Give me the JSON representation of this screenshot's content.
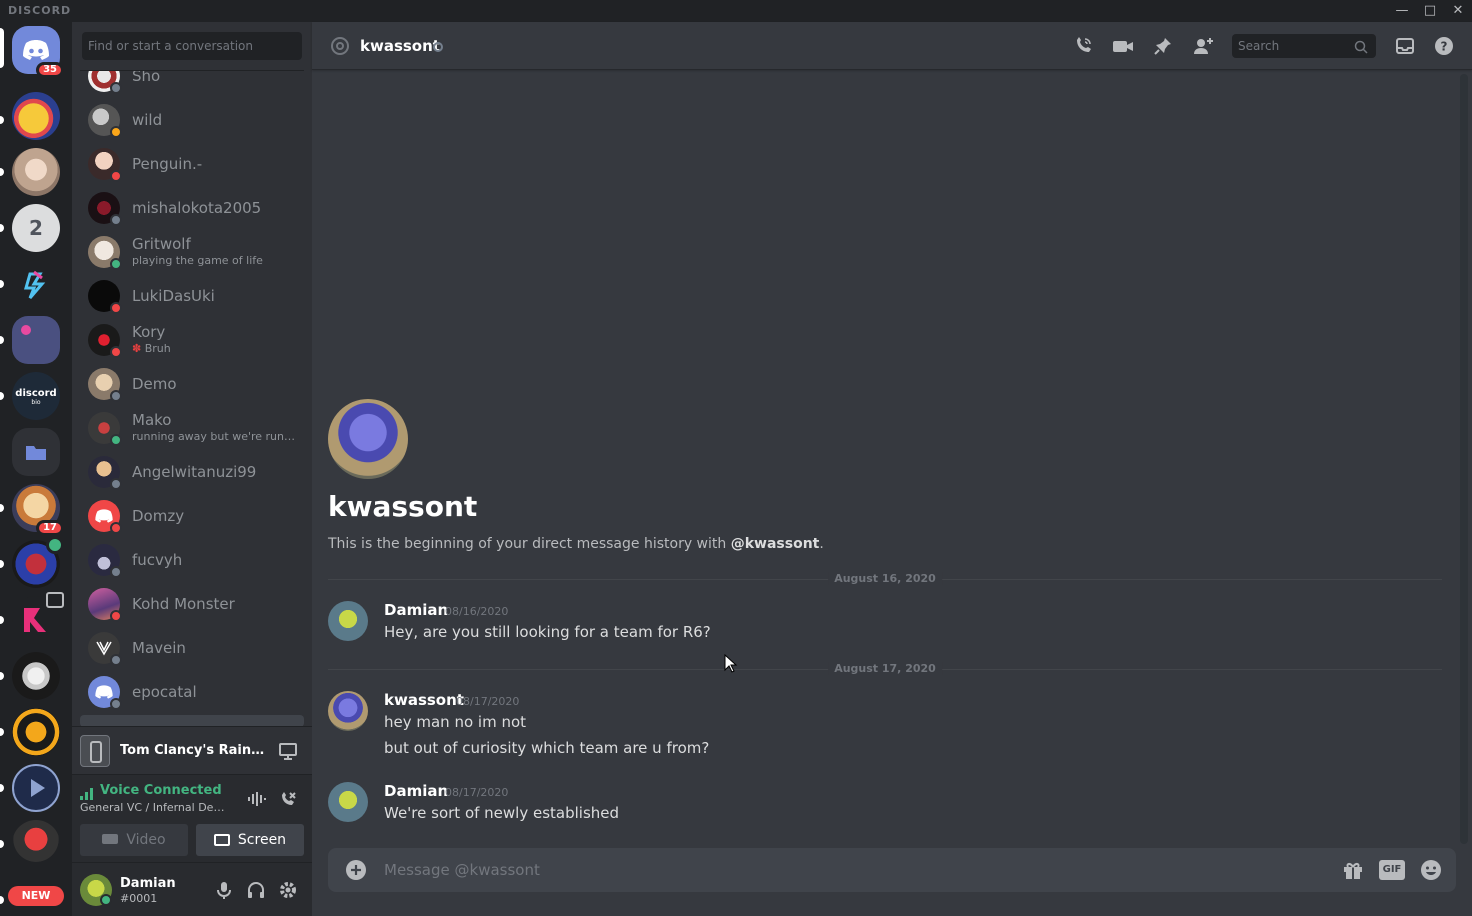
{
  "brand": "DISCORD",
  "colors": {
    "online": "#43b581",
    "idle": "#faa61a",
    "dnd": "#f04747",
    "offline": "#747f8d",
    "blurple": "#7289da"
  },
  "servers": [
    {
      "name": "home",
      "badge": "35"
    },
    {
      "name": "server-2"
    },
    {
      "name": "server-3"
    },
    {
      "name": "server-4",
      "glyph": "2"
    },
    {
      "name": "server-5"
    },
    {
      "name": "server-6"
    },
    {
      "name": "server-7",
      "label": "discord",
      "sublabel": "bio"
    },
    {
      "name": "folder"
    },
    {
      "name": "server-9",
      "badge": "17"
    },
    {
      "name": "server-10",
      "badge_icon": "speaker-icon"
    },
    {
      "name": "server-11",
      "badge_icon": "screen-icon"
    },
    {
      "name": "server-12"
    },
    {
      "name": "server-13"
    },
    {
      "name": "server-14"
    },
    {
      "name": "server-15"
    },
    {
      "name": "new",
      "label": "NEW"
    }
  ],
  "dm_search_placeholder": "Find or start a conversation",
  "dms": [
    {
      "name": "Sho",
      "status": "off"
    },
    {
      "name": "wild",
      "status": "idle"
    },
    {
      "name": "Penguin.-",
      "status": "dnd"
    },
    {
      "name": "mishalokota2005",
      "status": "off"
    },
    {
      "name": "Gritwolf",
      "status": "on",
      "sub": "playing the game of life"
    },
    {
      "name": "LukiDasUki",
      "status": "dnd"
    },
    {
      "name": "Kory",
      "status": "dnd",
      "sub": "Bruh"
    },
    {
      "name": "Demo",
      "status": "off"
    },
    {
      "name": "Mako",
      "status": "on",
      "sub": "running away but we're running in circles"
    },
    {
      "name": "Angelwitanuzi99",
      "status": "off"
    },
    {
      "name": "Domzy",
      "status": "dnd"
    },
    {
      "name": "fucvyh",
      "status": "off"
    },
    {
      "name": "Kohd Monster",
      "status": "dnd"
    },
    {
      "name": "Mavein",
      "status": "off"
    },
    {
      "name": "epocatal",
      "status": "off"
    }
  ],
  "activity": {
    "game": "Tom Clancy's Rainbow Six Siege"
  },
  "voice": {
    "status": "Voice Connected",
    "channel": "General VC / Infernal Devices",
    "video_label": "Video",
    "screen_label": "Screen"
  },
  "user": {
    "name": "Damian",
    "tag": "#0001"
  },
  "header": {
    "channel_name": "kwassont",
    "search_placeholder": "Search"
  },
  "intro": {
    "name": "kwassont",
    "text_prefix": "This is the beginning of your direct message history with ",
    "mention": "@kwassont",
    "text_suffix": "."
  },
  "dividers": [
    "August 16, 2020",
    "August 17, 2020"
  ],
  "messages": [
    {
      "author": "Damian",
      "time": "08/16/2020",
      "lines": [
        "Hey, are you still looking for a team for R6?"
      ]
    },
    {
      "author": "kwassont",
      "time": "08/17/2020",
      "lines": [
        "hey man no im not",
        "but out of curiosity which team are u from?"
      ]
    },
    {
      "author": "Damian",
      "time": "08/17/2020",
      "lines": [
        "We're sort of newly established"
      ]
    }
  ],
  "composer": {
    "placeholder": "Message @kwassont",
    "gif_label": "GIF"
  }
}
